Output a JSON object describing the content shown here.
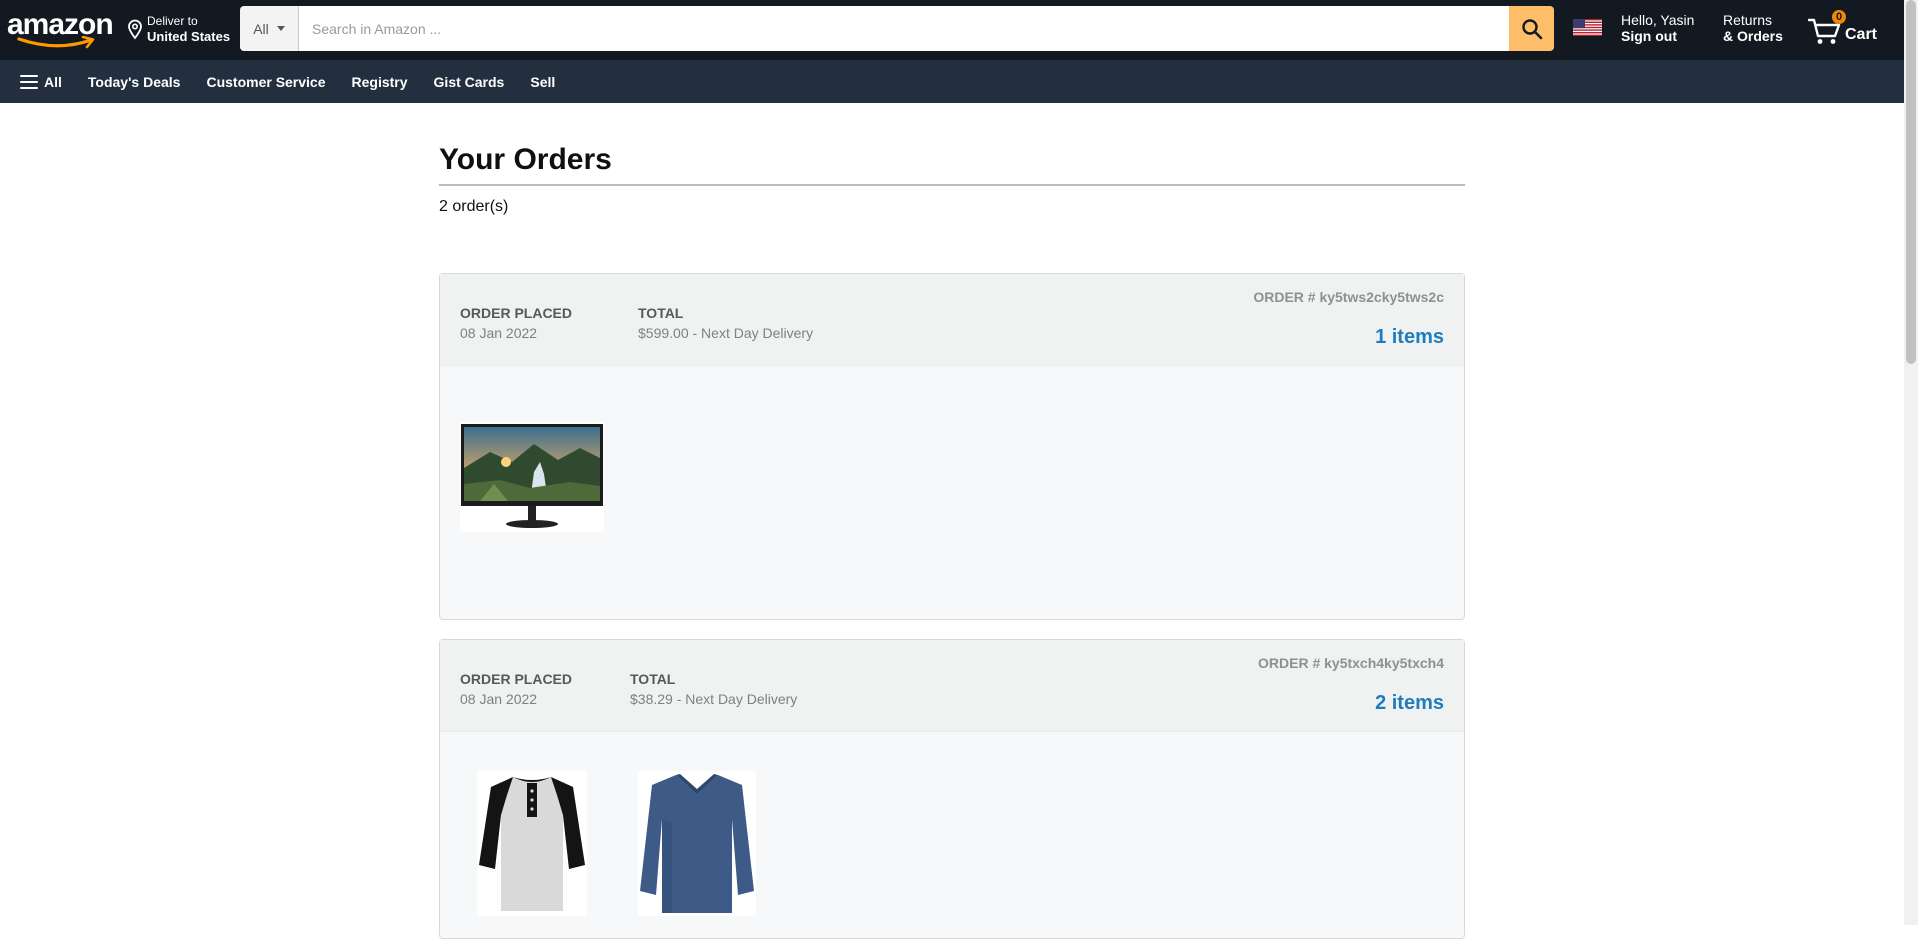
{
  "header": {
    "logo_text": "amazon",
    "deliver_line1": "Deliver to",
    "deliver_line2": "United States",
    "search_category": "All",
    "search_placeholder": "Search in Amazon ...",
    "account_line1": "Hello, Yasin",
    "account_line2": "Sign out",
    "returns_line1": "Returns",
    "returns_line2": "& Orders",
    "cart_count": "0",
    "cart_label": "Cart"
  },
  "nav": {
    "all_label": "All",
    "items": [
      "Today's Deals",
      "Customer Service",
      "Registry",
      "Gist Cards",
      "Sell"
    ]
  },
  "main": {
    "title": "Your Orders",
    "order_count": "2 order(s)"
  },
  "orders": [
    {
      "placed_label": "ORDER PLACED",
      "placed_date": "08 Jan 2022",
      "total_label": "TOTAL",
      "total_value": "$599.00 - Next Day Delivery",
      "order_id": "ORDER # ky5tws2cky5tws2c",
      "items_count": "1 items",
      "products": [
        "monitor-image"
      ]
    },
    {
      "placed_label": "ORDER PLACED",
      "placed_date": "08 Jan 2022",
      "total_label": "TOTAL",
      "total_value": "$38.29 - Next Day Delivery",
      "order_id": "ORDER # ky5txch4ky5txch4",
      "items_count": "2 items",
      "products": [
        "henley-shirt-image",
        "blue-sweater-image"
      ]
    }
  ],
  "colors": {
    "header_bg": "#131921",
    "nav_bg": "#232f3e",
    "search_button": "#febd69",
    "link_blue": "#1f7cbf"
  }
}
